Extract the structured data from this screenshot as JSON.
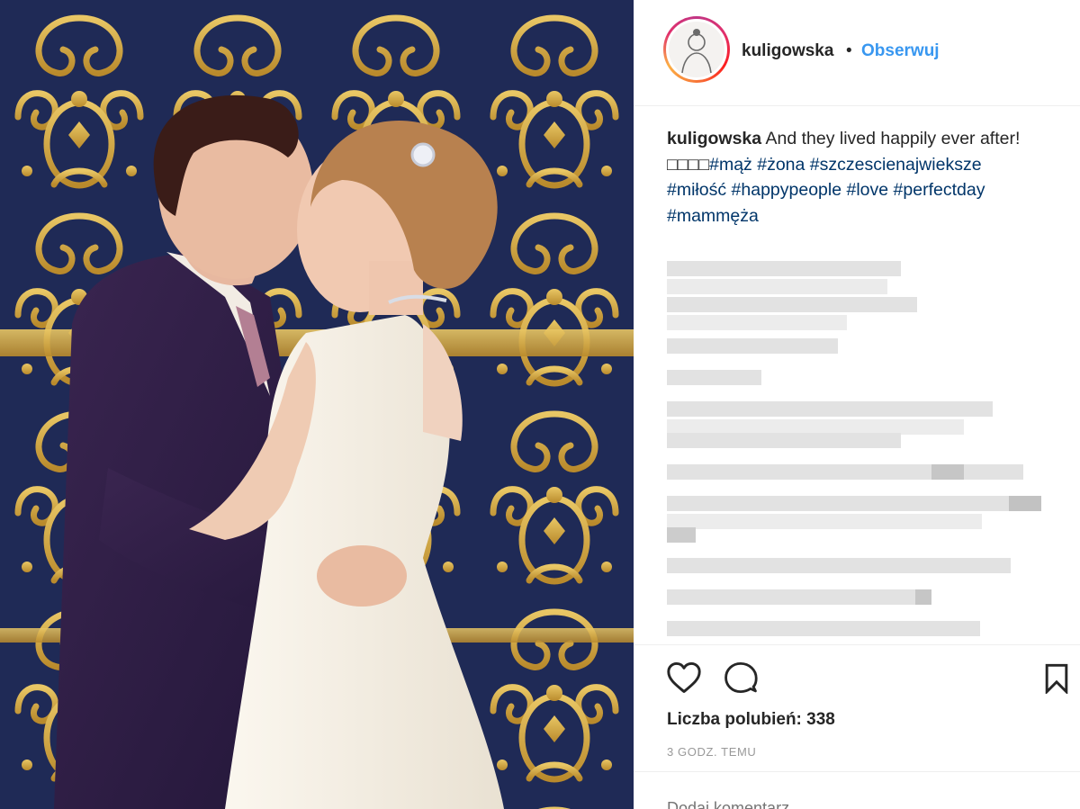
{
  "post": {
    "username": "kuligowska",
    "separator": "•",
    "follow_label": "Obserwuj",
    "caption": {
      "text": "And they lived happily ever after! □□□□",
      "hashtags": [
        "#mąż",
        "#żona",
        "#szczescienajwieksze",
        "#miłość",
        "#happypeople",
        "#love",
        "#perfectday",
        "#mammęża"
      ]
    },
    "likes_label": "Liczba polubień: 338",
    "time_label": "3 godz. temu",
    "comment_placeholder": "Dodaj komentarz..."
  },
  "icons": {
    "like": "heart-icon",
    "comment": "comment-bubble-icon",
    "save": "bookmark-icon"
  },
  "colors": {
    "follow": "#3897f0",
    "hashtag": "#003569",
    "muted": "#999999"
  }
}
